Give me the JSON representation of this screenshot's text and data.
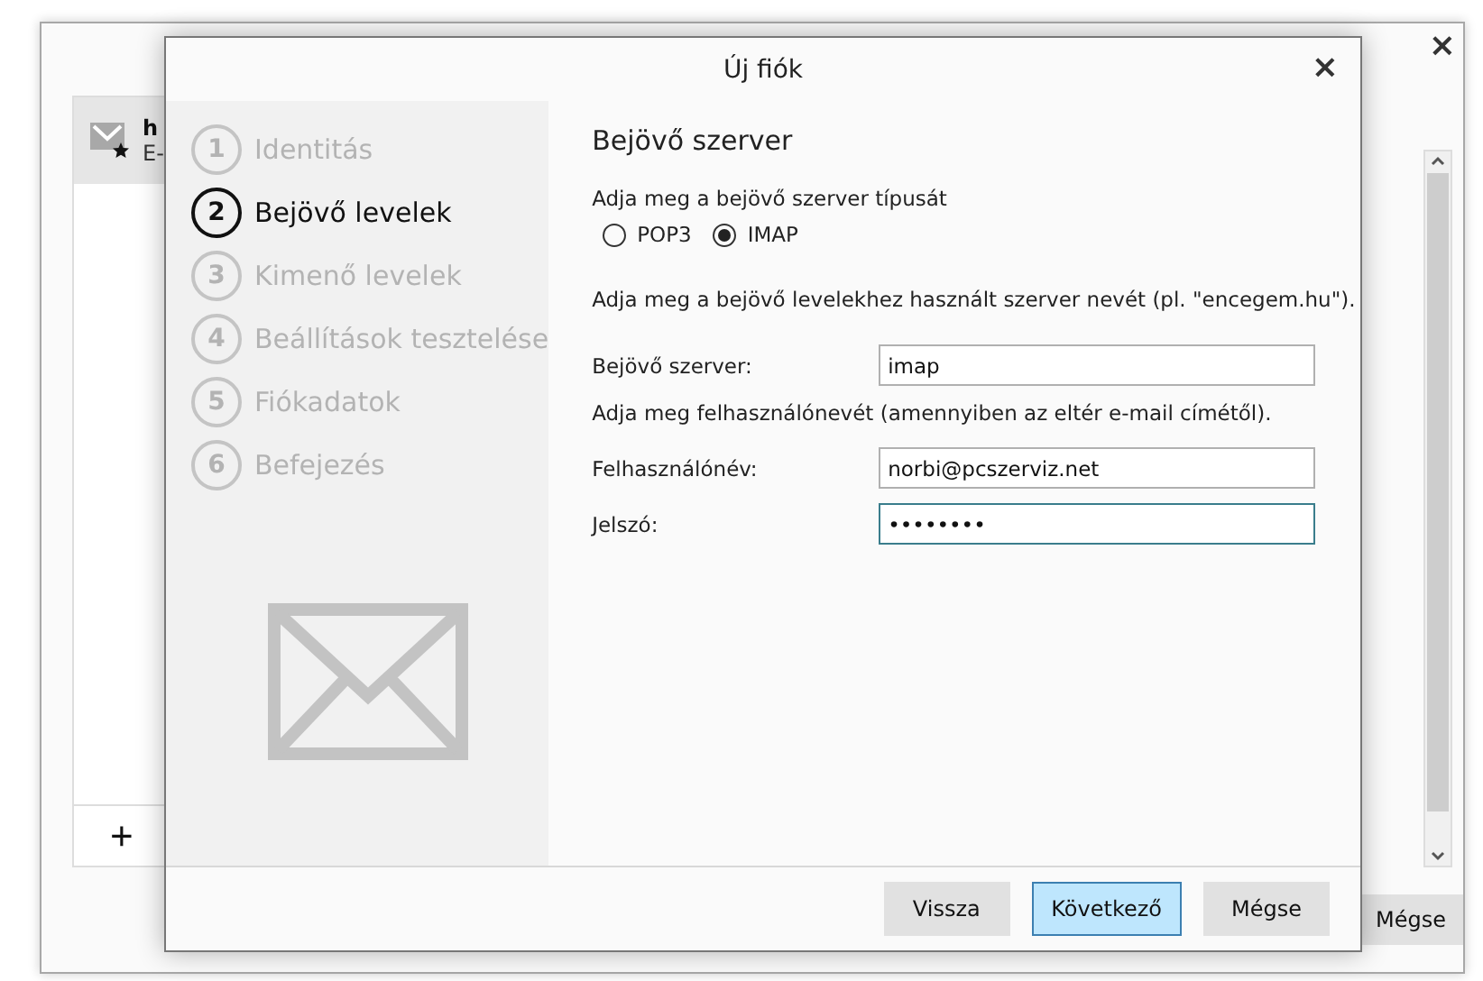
{
  "background_window": {
    "close": "×",
    "account": {
      "name": "h",
      "subtitle": "E-"
    },
    "add_button": "+",
    "cancel_button": "Mégse"
  },
  "dialog": {
    "title": "Új fiók",
    "close": "×",
    "steps": [
      {
        "number": "1",
        "label": "Identitás",
        "selected": false
      },
      {
        "number": "2",
        "label": "Bejövő levelek",
        "selected": true
      },
      {
        "number": "3",
        "label": "Kimenő levelek",
        "selected": false
      },
      {
        "number": "4",
        "label": "Beállítások tesztelése",
        "selected": false
      },
      {
        "number": "5",
        "label": "Fiókadatok",
        "selected": false
      },
      {
        "number": "6",
        "label": "Befejezés",
        "selected": false
      }
    ],
    "heading": "Bejövő szerver",
    "type_prompt": "Adja meg a bejövő szerver típusát",
    "server_types": [
      {
        "label": "POP3",
        "selected": false
      },
      {
        "label": "IMAP",
        "selected": true
      }
    ],
    "server_prompt": "Adja meg a bejövő levelekhez használt szerver nevét (pl. \"encegem.hu\").",
    "server_field": {
      "label": "Bejövő szerver:",
      "value": "imap",
      "focused": false
    },
    "username_prompt": "Adja meg felhasználónevét (amennyiben az eltér e-mail címétől).",
    "username_field": {
      "label": "Felhasználónév:",
      "value": "norbi@pcszerviz.net",
      "focused": false
    },
    "password_field": {
      "label": "Jelszó:",
      "value": "••••••••",
      "focused": true
    },
    "buttons": [
      {
        "label": "Vissza",
        "primary": false
      },
      {
        "label": "Következő",
        "primary": true
      },
      {
        "label": "Mégse",
        "primary": false
      }
    ]
  }
}
